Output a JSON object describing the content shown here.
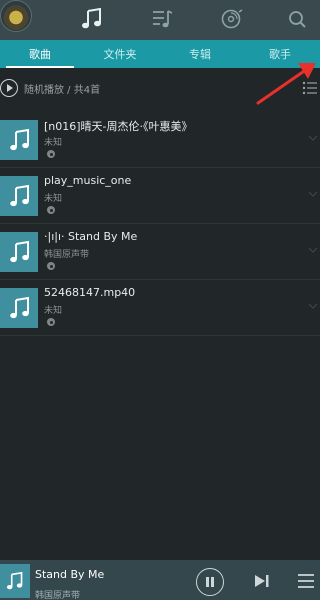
{
  "nav": {
    "icons": [
      "avatar",
      "music-note-icon",
      "playlist-icon",
      "disc-icon",
      "search-icon"
    ]
  },
  "tabs": [
    {
      "label": "歌曲",
      "active": true
    },
    {
      "label": "文件夹",
      "active": false
    },
    {
      "label": "专辑",
      "active": false
    },
    {
      "label": "歌手",
      "active": false
    }
  ],
  "shuffle": {
    "label": "随机播放 / 共4首"
  },
  "songs": [
    {
      "title": "[n016]晴天-周杰伦·《叶惠美》",
      "artist": "未知"
    },
    {
      "title": "play_music_one",
      "artist": "未知"
    },
    {
      "title": "·|ı|ı· Stand By Me",
      "artist": "韩国原声带"
    },
    {
      "title": "52468147.mp40",
      "artist": "未知"
    }
  ],
  "player": {
    "title": "Stand By Me",
    "artist": "韩国原声带"
  },
  "colors": {
    "tab_bar": "#1b9aa5",
    "topbar": "#39494e",
    "background": "#212628",
    "thumb": "#3f8f9e",
    "annotation_arrow": "#e8312a"
  }
}
